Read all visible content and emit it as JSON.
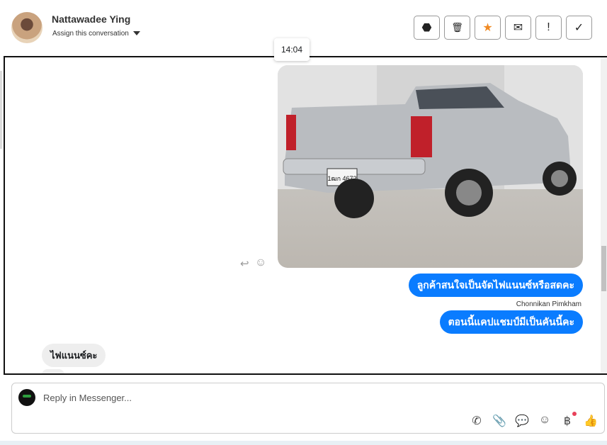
{
  "header": {
    "name": "Nattawadee Ying",
    "assign_label": "Assign this conversation",
    "actions": [
      {
        "name": "spam",
        "glyph": "⬣"
      },
      {
        "name": "delete",
        "glyph": "🗑"
      },
      {
        "name": "star",
        "glyph": "★"
      },
      {
        "name": "mark-unread",
        "glyph": "✉"
      },
      {
        "name": "important",
        "glyph": "!"
      },
      {
        "name": "done",
        "glyph": "✓"
      }
    ]
  },
  "tooltip": "14:04",
  "messages": {
    "out1": "ลูกค้าสนใจเป็นจัดไฟแนนซ์หรือสดคะ",
    "sender": "Chonnikan Pimkham",
    "out2": "ตอนนี้แคปแชมป์มีเป็นคันนี้คะ",
    "in1": "ไฟแนนซ์คะ",
    "plate": "1ฒก 4672"
  },
  "composer": {
    "placeholder": "Reply in Messenger..."
  },
  "colors": {
    "accent": "#0a7cff",
    "star": "#f08a24"
  }
}
